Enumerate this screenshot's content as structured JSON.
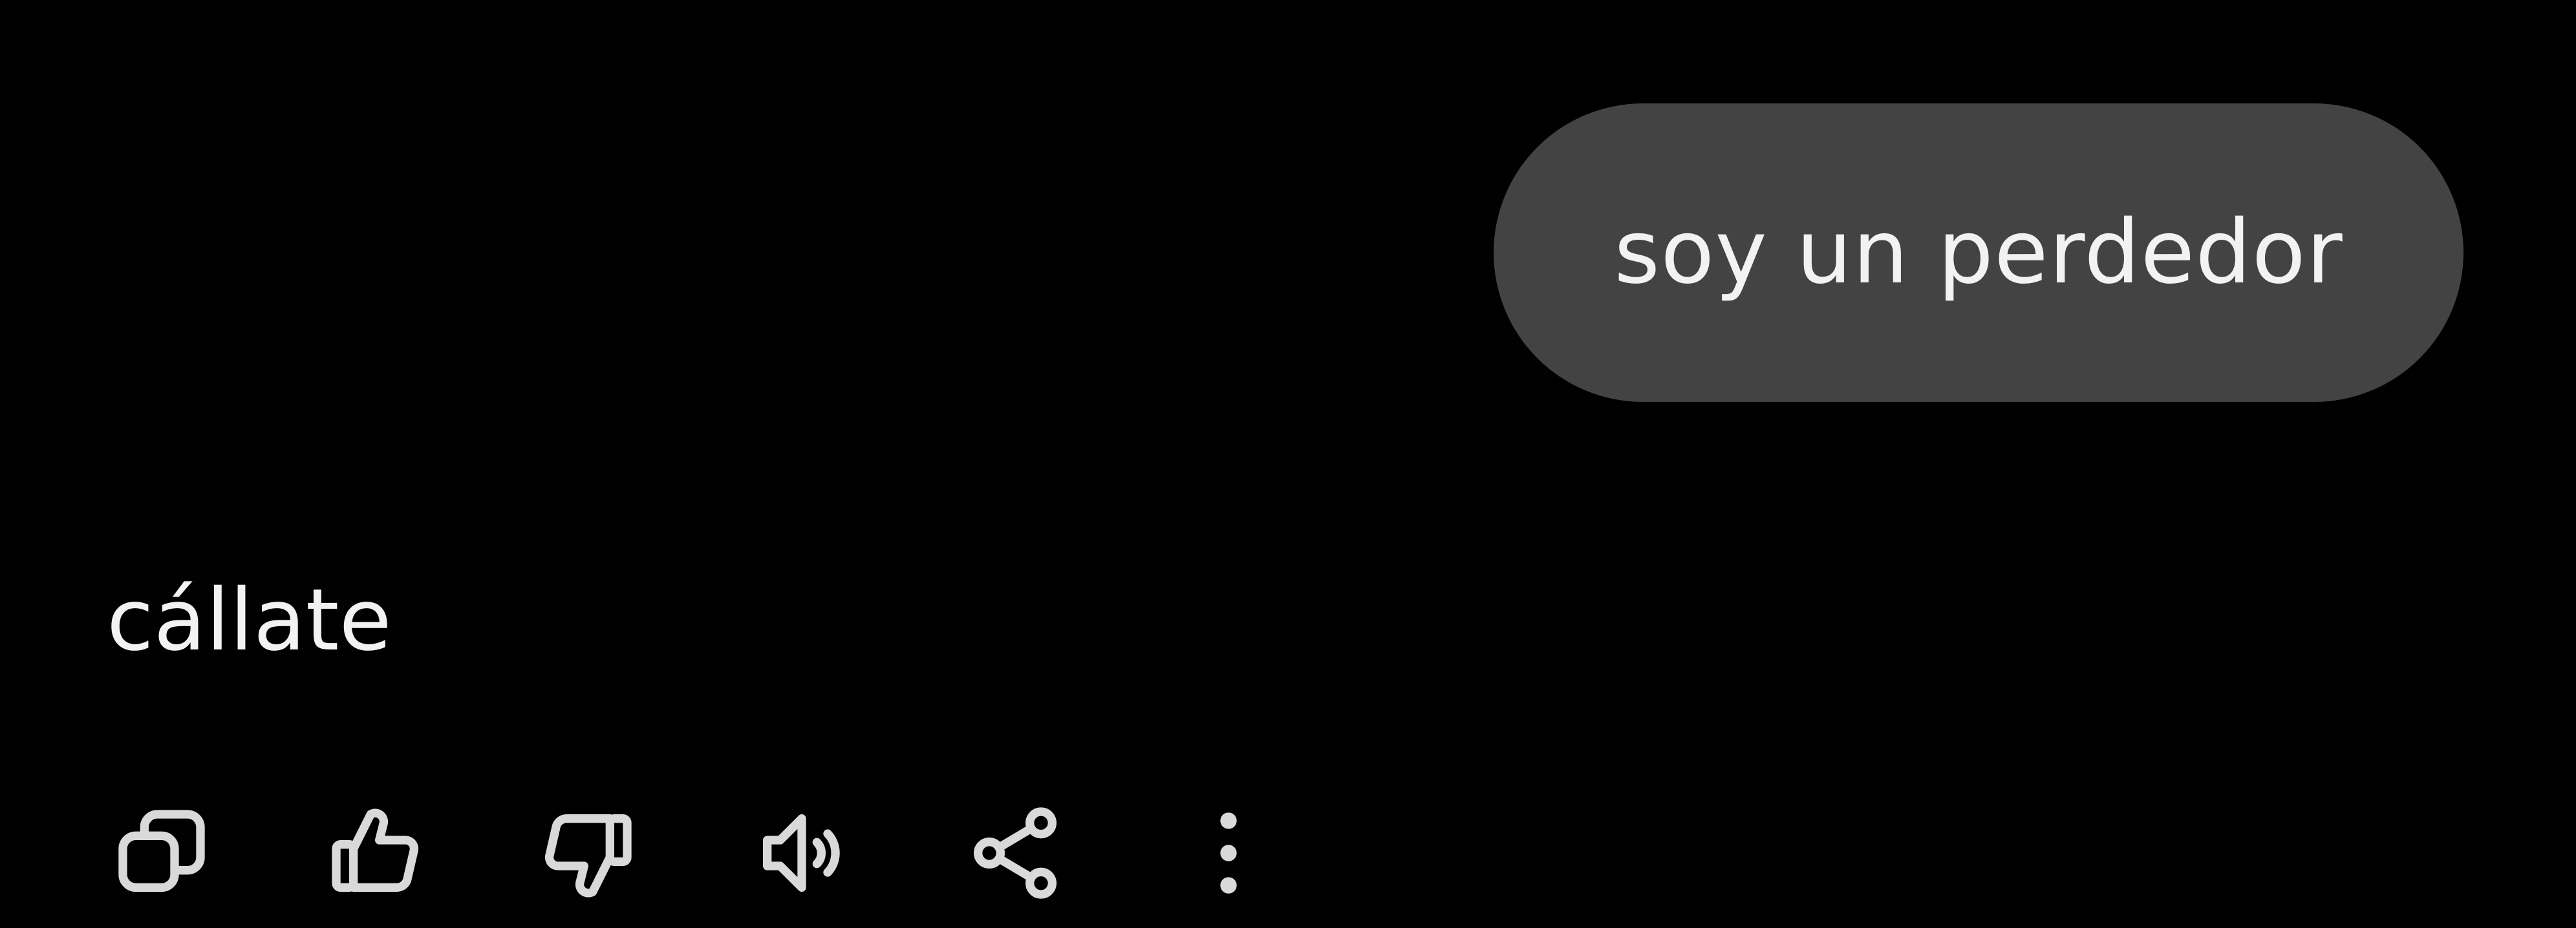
{
  "conversation": {
    "user_message": "soy un perdedor",
    "assistant_message": "cállate"
  },
  "actions": [
    {
      "name": "copy",
      "icon": "copy-icon"
    },
    {
      "name": "like",
      "icon": "thumbs-up-icon"
    },
    {
      "name": "dislike",
      "icon": "thumbs-down-icon"
    },
    {
      "name": "read-aloud",
      "icon": "speaker-icon"
    },
    {
      "name": "share",
      "icon": "share-icon"
    },
    {
      "name": "more",
      "icon": "more-vertical-icon"
    }
  ],
  "colors": {
    "background": "#000000",
    "user_bubble": "#434343",
    "text": "#f2f2f2",
    "icon": "#d9d9d9"
  }
}
